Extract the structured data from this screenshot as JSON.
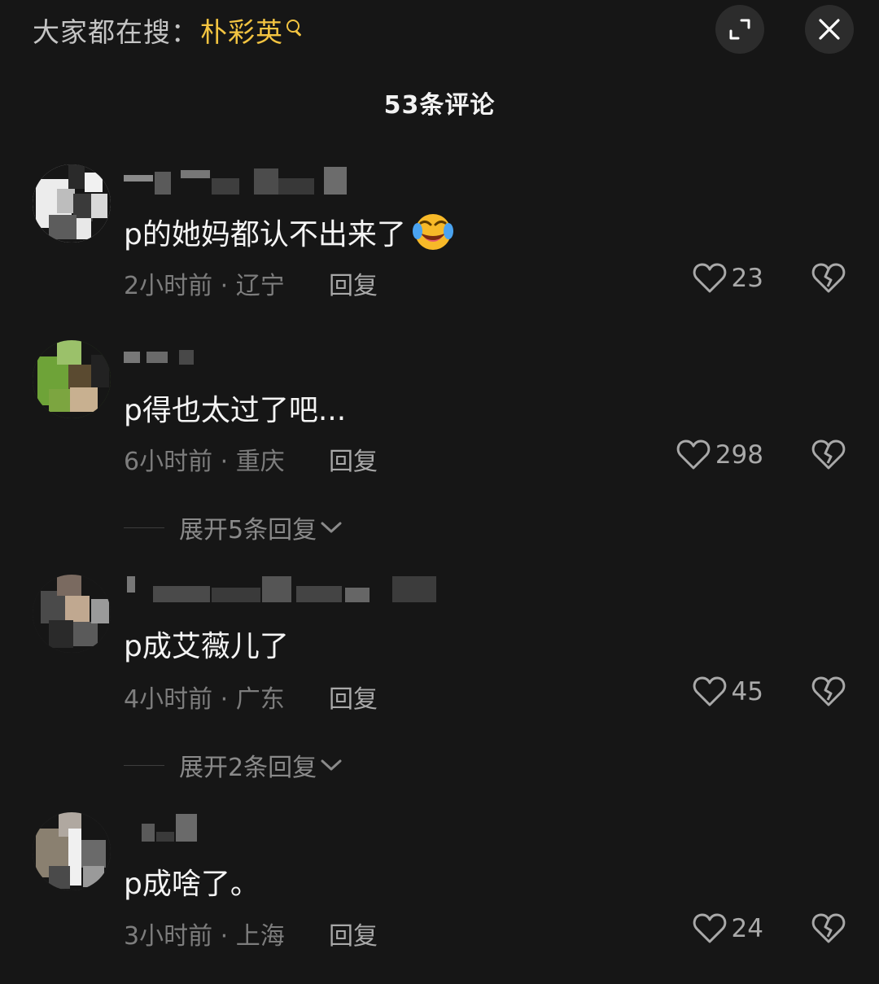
{
  "header": {
    "search_prefix": "大家都在搜：",
    "search_keyword": "朴彩英",
    "expand_icon": "expand-icon",
    "close_icon": "close-icon"
  },
  "comment_count": "53条评论",
  "colors": {
    "background": "#161616",
    "keyword": "#f3c441",
    "primary_text": "#f4f4f4",
    "secondary_text": "#7d7d7d"
  },
  "comments": [
    {
      "text": "p的她妈都认不出来了",
      "emoji": "rolling-on-floor-laughing-emoji",
      "meta": "2小时前 · 辽宁",
      "reply": "回复",
      "likes": "23"
    },
    {
      "text": "p得也太过了吧...",
      "meta": "6小时前 · 重庆",
      "reply": "回复",
      "likes": "298",
      "expand_replies": "展开5条回复"
    },
    {
      "text": "p成艾薇儿了",
      "meta": "4小时前 · 广东",
      "reply": "回复",
      "likes": "45",
      "expand_replies": "展开2条回复"
    },
    {
      "text": "p成啥了。",
      "meta": "3小时前 · 上海",
      "reply": "回复",
      "likes": "24"
    }
  ]
}
